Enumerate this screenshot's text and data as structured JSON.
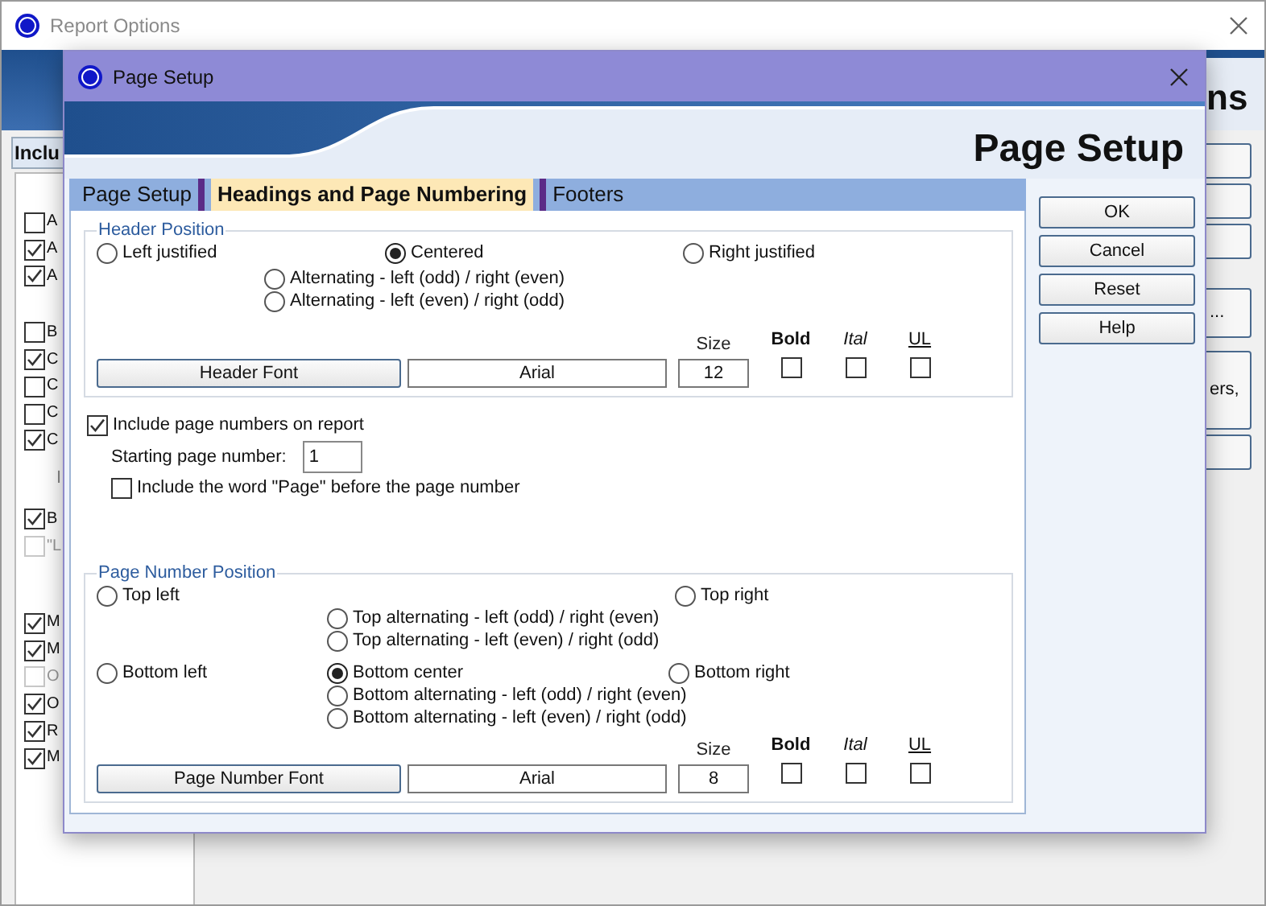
{
  "background_window": {
    "title": "Report Options",
    "heading": "ns",
    "tab": "Inclu",
    "groups": [
      [
        {
          "kind": "checkbox",
          "label": "A",
          "checked": false,
          "disabled": false
        },
        {
          "kind": "checkbox",
          "label": "A",
          "checked": true,
          "disabled": false
        },
        {
          "kind": "checkbox",
          "label": "A",
          "checked": true,
          "disabled": false
        }
      ],
      [
        {
          "kind": "checkbox",
          "label": "B",
          "checked": false,
          "disabled": false
        },
        {
          "kind": "checkbox",
          "label": "C",
          "checked": true,
          "disabled": false
        },
        {
          "kind": "checkbox",
          "label": "C",
          "checked": false,
          "disabled": false
        },
        {
          "kind": "checkbox",
          "label": "C",
          "checked": false,
          "disabled": false
        },
        {
          "kind": "checkbox",
          "label": "C",
          "checked": true,
          "disabled": false
        },
        {
          "kind": "label",
          "label": "I"
        }
      ],
      [
        {
          "kind": "checkbox",
          "label": "B",
          "checked": true,
          "disabled": false
        },
        {
          "kind": "checkbox",
          "label": "\"L",
          "checked": false,
          "disabled": true
        }
      ],
      [
        {
          "kind": "checkbox",
          "label": "M",
          "checked": true,
          "disabled": false
        },
        {
          "kind": "checkbox",
          "label": "M",
          "checked": true,
          "disabled": false
        },
        {
          "kind": "checkbox",
          "label": "O",
          "checked": false,
          "disabled": true
        },
        {
          "kind": "checkbox",
          "label": "O",
          "checked": true,
          "disabled": false
        },
        {
          "kind": "checkbox",
          "label": "R",
          "checked": true,
          "disabled": false
        },
        {
          "kind": "checkbox",
          "label": "M",
          "checked": true,
          "disabled": false
        }
      ]
    ],
    "side_buttons": [
      {
        "kind": "blank"
      },
      {
        "kind": "blank"
      },
      {
        "kind": "blank"
      },
      {
        "kind": "text",
        "label": "..."
      },
      {
        "kind": "text",
        "label": "ers,"
      },
      {
        "kind": "blank"
      }
    ]
  },
  "dialog": {
    "title": "Page Setup",
    "banner_title": "Page Setup",
    "tabs": [
      {
        "label": "Page Setup",
        "selected": false
      },
      {
        "label": "Headings and Page Numbering",
        "selected": true
      },
      {
        "label": "Footers",
        "selected": false
      }
    ],
    "header_position": {
      "title": "Header Position",
      "options": [
        {
          "label": "Left justified",
          "selected": false
        },
        {
          "label": "Centered",
          "selected": true
        },
        {
          "label": "Right justified",
          "selected": false
        },
        {
          "label": "Alternating - left (odd) / right (even)",
          "selected": false
        },
        {
          "label": "Alternating - left (even) / right (odd)",
          "selected": false
        }
      ],
      "font": {
        "button": "Header Font",
        "name": "Arial",
        "size_label": "Size",
        "size": "12",
        "bold_label": "Bold",
        "bold": false,
        "italic_label": "Ital",
        "italic": false,
        "underline_label": "UL",
        "underline": false
      }
    },
    "include_page_numbers": {
      "label": "Include page numbers on report",
      "checked": true
    },
    "starting_page": {
      "label": "Starting page number:",
      "value": "1"
    },
    "include_word_page": {
      "label": "Include the word \"Page\" before the page number",
      "checked": false
    },
    "page_number_position": {
      "title": "Page Number Position",
      "options": [
        {
          "label": "Top left",
          "selected": false
        },
        {
          "label": "Top right",
          "selected": false
        },
        {
          "label": "Top alternating - left (odd) / right (even)",
          "selected": false
        },
        {
          "label": "Top alternating - left (even) / right (odd)",
          "selected": false
        },
        {
          "label": "Bottom left",
          "selected": false
        },
        {
          "label": "Bottom center",
          "selected": true
        },
        {
          "label": "Bottom right",
          "selected": false
        },
        {
          "label": "Bottom alternating - left (odd) / right (even)",
          "selected": false
        },
        {
          "label": "Bottom alternating - left (even) / right (odd)",
          "selected": false
        }
      ],
      "font": {
        "button": "Page Number Font",
        "name": "Arial",
        "size_label": "Size",
        "size": "8",
        "bold_label": "Bold",
        "bold": false,
        "italic_label": "Ital",
        "italic": false,
        "underline_label": "UL",
        "underline": false
      }
    },
    "buttons": [
      "OK",
      "Cancel",
      "Reset",
      "Help"
    ]
  }
}
